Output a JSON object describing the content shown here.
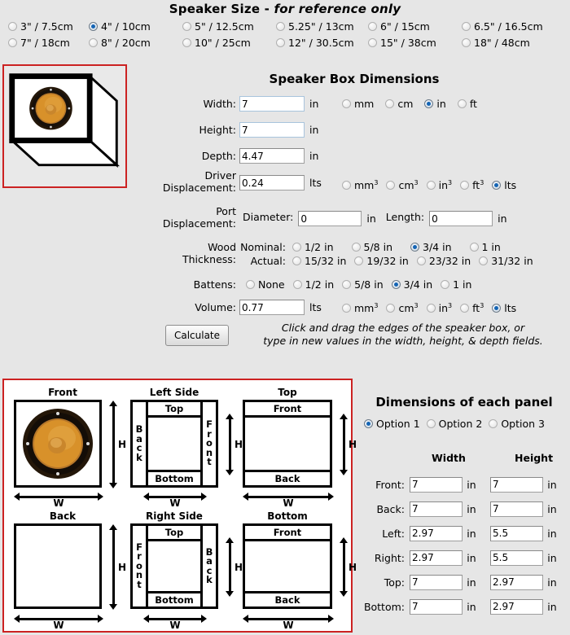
{
  "header": {
    "title_main": "Speaker Size - ",
    "title_em": "for reference only",
    "sizes": [
      {
        "label": "3\" / 7.5cm",
        "selected": false
      },
      {
        "label": "4\" / 10cm",
        "selected": true
      },
      {
        "label": "5\" / 12.5cm",
        "selected": false
      },
      {
        "label": "5.25\" / 13cm",
        "selected": false
      },
      {
        "label": "6\" / 15cm",
        "selected": false
      },
      {
        "label": "6.5\" / 16.5cm",
        "selected": false
      },
      {
        "label": "7\" / 18cm",
        "selected": false
      },
      {
        "label": "8\" / 20cm",
        "selected": false
      },
      {
        "label": "10\" / 25cm",
        "selected": false
      },
      {
        "label": "12\" / 30.5cm",
        "selected": false
      },
      {
        "label": "15\" / 38cm",
        "selected": false
      },
      {
        "label": "18\" / 48cm",
        "selected": false
      }
    ]
  },
  "box_form": {
    "title": "Speaker Box Dimensions",
    "width": {
      "label": "Width:",
      "value": "7",
      "unit": "in"
    },
    "height": {
      "label": "Height:",
      "value": "7",
      "unit": "in"
    },
    "depth": {
      "label": "Depth:",
      "value": "4.47",
      "unit": "in"
    },
    "length_units": [
      {
        "label": "mm",
        "selected": false
      },
      {
        "label": "cm",
        "selected": false
      },
      {
        "label": "in",
        "selected": true
      },
      {
        "label": "ft",
        "selected": false
      }
    ],
    "driver_displacement": {
      "label_l1": "Driver",
      "label_l2": "Displacement:",
      "value": "0.24",
      "unit": "lts",
      "units": [
        {
          "label": "mm",
          "sup": "3",
          "selected": false
        },
        {
          "label": "cm",
          "sup": "3",
          "selected": false
        },
        {
          "label": "in",
          "sup": "3",
          "selected": false
        },
        {
          "label": "ft",
          "sup": "3",
          "selected": false
        },
        {
          "label": "lts",
          "sup": "",
          "selected": true
        }
      ]
    },
    "port_displacement": {
      "label_l1": "Port",
      "label_l2": "Displacement:",
      "diameter_label": "Diameter:",
      "diameter_value": "0",
      "diameter_unit": "in",
      "length_label": "Length:",
      "length_value": "0",
      "length_unit": "in"
    },
    "wood_thickness": {
      "label_l1": "Wood",
      "label_l2": "Thickness:",
      "nominal_label": "Nominal:",
      "nominal": [
        {
          "label": "1/2 in",
          "selected": false
        },
        {
          "label": "5/8 in",
          "selected": false
        },
        {
          "label": "3/4 in",
          "selected": true
        },
        {
          "label": "1 in",
          "selected": false
        }
      ],
      "actual_label": "Actual:",
      "actual": [
        {
          "label": "15/32 in",
          "selected": false
        },
        {
          "label": "19/32 in",
          "selected": false
        },
        {
          "label": "23/32 in",
          "selected": false
        },
        {
          "label": "31/32 in",
          "selected": false
        }
      ]
    },
    "battens": {
      "label": "Battens:",
      "options": [
        {
          "label": "None",
          "selected": false
        },
        {
          "label": "1/2 in",
          "selected": false
        },
        {
          "label": "5/8 in",
          "selected": false
        },
        {
          "label": "3/4 in",
          "selected": true
        },
        {
          "label": "1 in",
          "selected": false
        }
      ]
    },
    "volume": {
      "label": "Volume:",
      "value": "0.77",
      "unit": "lts",
      "units": [
        {
          "label": "mm",
          "sup": "3",
          "selected": false
        },
        {
          "label": "cm",
          "sup": "3",
          "selected": false
        },
        {
          "label": "in",
          "sup": "3",
          "selected": false
        },
        {
          "label": "ft",
          "sup": "3",
          "selected": false
        },
        {
          "label": "lts",
          "sup": "",
          "selected": true
        }
      ]
    },
    "calculate_label": "Calculate",
    "hint_l1": "Click and drag the edges of the speaker box, or",
    "hint_l2": "type in new values in the width, height, & depth fields."
  },
  "panels": {
    "front": {
      "title": "Front",
      "w_label": "W",
      "h_label": "H"
    },
    "left_side": {
      "title": "Left Side",
      "left_strip": "Back",
      "right_strip": "Front",
      "top_strip": "Top",
      "bottom_strip": "Bottom",
      "w_label": "W",
      "h_label": "H"
    },
    "top": {
      "title": "Top",
      "top_strip": "Front",
      "bottom_strip": "Back",
      "w_label": "W",
      "h_label": "H"
    },
    "back": {
      "title": "Back",
      "w_label": "W",
      "h_label": "H"
    },
    "right_side": {
      "title": "Right Side",
      "left_strip": "Front",
      "right_strip": "Back",
      "top_strip": "Top",
      "bottom_strip": "Bottom",
      "w_label": "W",
      "h_label": "H"
    },
    "bottom": {
      "title": "Bottom",
      "top_strip": "Front",
      "bottom_strip": "Back",
      "w_label": "W",
      "h_label": "H"
    }
  },
  "results": {
    "title": "Dimensions of each panel",
    "options": [
      {
        "label": "Option 1",
        "selected": true
      },
      {
        "label": "Option 2",
        "selected": false
      },
      {
        "label": "Option 3",
        "selected": false
      }
    ],
    "col_width": "Width",
    "col_height": "Height",
    "unit": "in",
    "rows": [
      {
        "name": "Front:",
        "width": "7",
        "height": "7"
      },
      {
        "name": "Back:",
        "width": "7",
        "height": "7"
      },
      {
        "name": "Left:",
        "width": "2.97",
        "height": "5.5"
      },
      {
        "name": "Right:",
        "width": "2.97",
        "height": "5.5"
      },
      {
        "name": "Top:",
        "width": "7",
        "height": "2.97"
      },
      {
        "name": "Bottom:",
        "width": "7",
        "height": "2.97"
      }
    ]
  },
  "colors": {
    "background": "#e6e6e6",
    "accent_red": "#cc2222",
    "radio_blue": "#1464b4",
    "speaker_cone": "#d8912a",
    "speaker_rim": "#2b1d10"
  }
}
